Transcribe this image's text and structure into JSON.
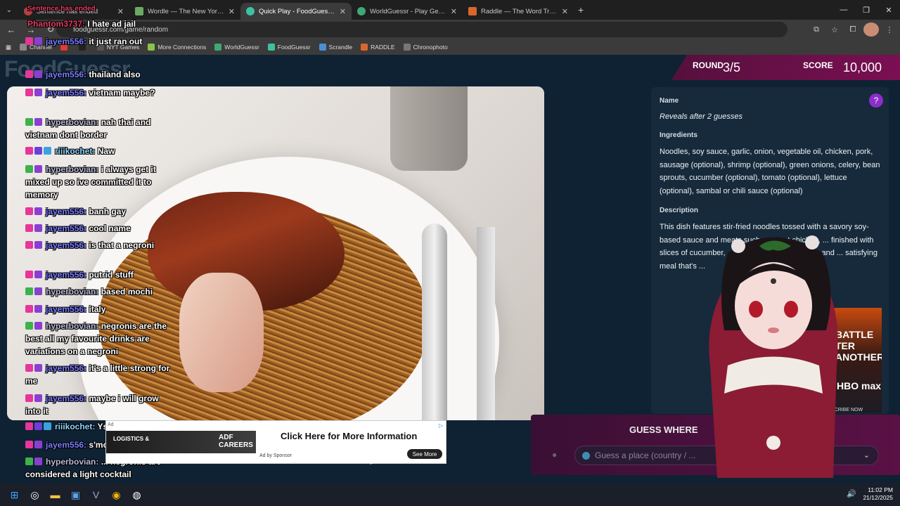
{
  "browser": {
    "tabs": [
      {
        "title": "Sentence has ended",
        "fav": "#b94040"
      },
      {
        "title": "Wordle — The New York Times",
        "fav": "#6aaa64"
      },
      {
        "title": "Quick Play - FoodGuessr | Food",
        "fav": "#3ec1a1"
      },
      {
        "title": "WorldGuessr - Play Geoguessr",
        "fav": "#3fa874"
      },
      {
        "title": "Raddle — The Word Transform",
        "fav": "#d9662f"
      }
    ],
    "url": "foodguessr.com/game/random",
    "bookmarks": [
      {
        "label": "Channel",
        "color": "#888"
      },
      {
        "label": "",
        "color": "#e53935"
      },
      {
        "label": "",
        "color": "#222"
      },
      {
        "label": "NYT Games",
        "color": "#555"
      },
      {
        "label": "More Connections",
        "color": "#8bc34a"
      },
      {
        "label": "WorldGuessr",
        "color": "#3fa874"
      },
      {
        "label": "FoodGuessr",
        "color": "#3ec1a1"
      },
      {
        "label": "Scrandle",
        "color": "#4a8fd4"
      },
      {
        "label": "RADDLE",
        "color": "#d9662f"
      },
      {
        "label": "Chronophoto",
        "color": "#777"
      }
    ]
  },
  "game": {
    "logo": "FoodGuessr",
    "round_label": "ROUND",
    "round_value": "3/5",
    "score_label": "SCORE",
    "score_value": "10,000",
    "info": {
      "name_h": "Name",
      "name_b": "Reveals after 2 guesses",
      "ing_h": "Ingredients",
      "ing_b": "Noodles, soy sauce, garlic, onion, vegetable oil, chicken, pork, sausage (optional), shrimp (optional), green onions, celery, bean sprouts, cucumber (optional), tomato (optional), lettuce (optional), sambal or chili sauce (optional)",
      "desc_h": "Description",
      "desc_b": "This dish features stir-fried noodles tossed with a savory soy-based sauce and meats such as roast chicken, ... finished with slices of cucumber, ... combines vibrant flavors and ... satisfying meal that's ..."
    },
    "guess": {
      "heading": "GUESS WHERE",
      "placeholder": "Guess a place (country / ..."
    }
  },
  "ad_side": {
    "title": "BATTLE TER ANOTHER",
    "brand": "HBO max",
    "cta": "SCRIBE NOW"
  },
  "ad_bottom": {
    "tag": "Ad",
    "left1": "LOGISTICS &",
    "left2": "ADF CAREERS",
    "headline": "Click Here for More Information",
    "by": "Ad by Sponsor",
    "button": "See More"
  },
  "chat": [
    {
      "user": "Sentence has ended",
      "msg": "",
      "ucls": "ph"
    },
    {
      "user": "Phantom3737:",
      "msg": "I hate ad jail",
      "ucls": "ph"
    },
    {
      "user": "jayem556:",
      "msg": "it just ran out",
      "ucls": "jay"
    },
    {
      "user": "jayem556:",
      "msg": "thailand also",
      "ucls": "jay"
    },
    {
      "user": "jayem556:",
      "msg": "vietnam maybe?",
      "ucls": "jay"
    },
    {
      "user": "hyperbovian:",
      "msg": "nah thai and vietnam dont border",
      "ucls": "hyp"
    },
    {
      "user": "riiikochet:",
      "msg": "Naw",
      "ucls": "rii"
    },
    {
      "user": "hyperbovian:",
      "msg": "i always get it mixed up so ive committed it to memory",
      "ucls": "hyp"
    },
    {
      "user": "jayem556:",
      "msg": "banh gay",
      "ucls": "jay"
    },
    {
      "user": "jayem556:",
      "msg": "cool name",
      "ucls": "jay"
    },
    {
      "user": "jayem556:",
      "msg": "is that a negroni",
      "ucls": "jay"
    },
    {
      "user": "jayem556:",
      "msg": "putrid stuff",
      "ucls": "jay"
    },
    {
      "user": "hyperbovian:",
      "msg": "based mochi",
      "ucls": "hyp"
    },
    {
      "user": "jayem556:",
      "msg": "italy",
      "ucls": "jay"
    },
    {
      "user": "hyperbovian:",
      "msg": "negronis are the best all my favourite drinks are variations on a negroni",
      "ucls": "hyp"
    },
    {
      "user": "jayem556:",
      "msg": "it's a little strong for me",
      "ucls": "jay"
    },
    {
      "user": "jayem556:",
      "msg": "maybe i will grow into it",
      "ucls": "jay"
    },
    {
      "user": "riiikochet:",
      "msg": "Ysa",
      "ucls": "rii"
    },
    {
      "user": "jayem556:",
      "msg": "s'mores",
      "ucls": "jay"
    },
    {
      "user": "hyperbovian:",
      "msg": "... negronis are considered a light cocktail",
      "ucls": "hyp"
    }
  ],
  "taskbar": {
    "time": "11:02 PM",
    "date": "21/12/2025"
  }
}
